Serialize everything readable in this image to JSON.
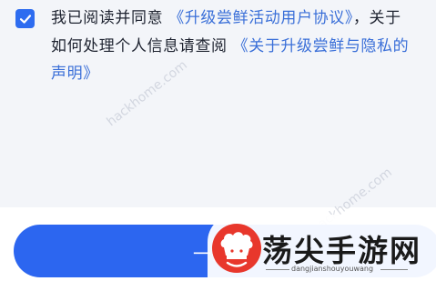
{
  "agreement": {
    "checked": true,
    "checkbox_icon": "checkmark-icon",
    "line1_text": "我已阅读并同意",
    "link1_text": "《升级尝鲜活动用户协议》",
    "mid_text": "，关于如何处理个人信息请查阅",
    "link2_text": "《关于升级尝鲜与隐私的声明》"
  },
  "primary_button": {
    "label": "一键"
  },
  "watermark": {
    "text": "hackhome.com"
  },
  "logo": {
    "icon": "chef-hat-icon",
    "title": "荡尖手游网",
    "subtitle": "dangjianshouyouwang"
  },
  "colors": {
    "accent": "#2c66f0",
    "link": "#3a6fd8",
    "text": "#1e2330",
    "panel_bg": "#f3f5f9",
    "logo_red": "#e8372c"
  }
}
